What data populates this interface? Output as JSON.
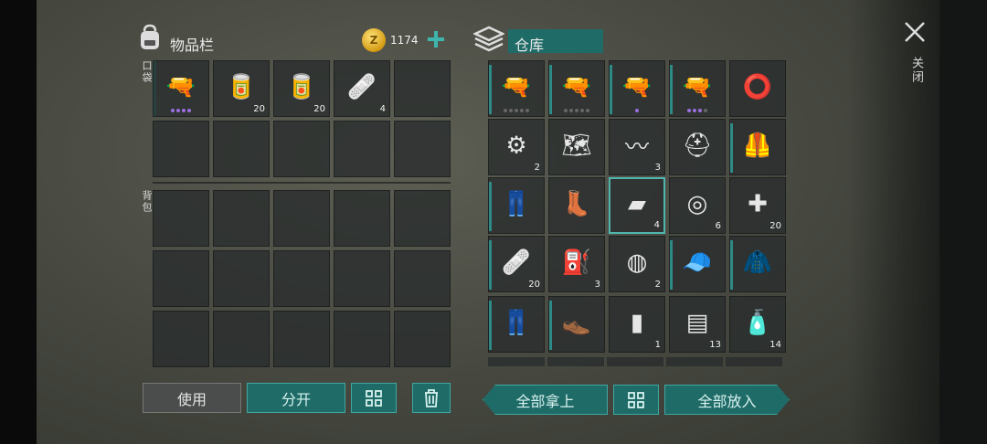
{
  "inventory": {
    "title": "物品栏",
    "pocket_label": "口袋",
    "backpack_label": "背包",
    "coins": "1174",
    "pocket_items": [
      {
        "name": "rifle",
        "count": "",
        "dots": [
          "p",
          "p",
          "p",
          "p"
        ]
      },
      {
        "name": "canned-food",
        "count": "20"
      },
      {
        "name": "canned-food",
        "count": "20"
      },
      {
        "name": "bandage",
        "count": "4"
      }
    ]
  },
  "storage": {
    "title": "仓库",
    "items": [
      {
        "name": "ak-rifle",
        "count": "",
        "dots": [
          "g",
          "g",
          "g",
          "g",
          "g"
        ]
      },
      {
        "name": "ak-rifle",
        "count": "",
        "dots": [
          "g",
          "g",
          "g",
          "g",
          "g"
        ]
      },
      {
        "name": "ak-rifle",
        "count": "",
        "dots": [
          "p"
        ]
      },
      {
        "name": "ak-rifle",
        "count": "",
        "dots": [
          "p",
          "p",
          "p",
          "g"
        ]
      },
      {
        "name": "wheel",
        "count": ""
      },
      {
        "name": "engine-part",
        "count": "2"
      },
      {
        "name": "maps",
        "count": ""
      },
      {
        "name": "spring",
        "count": "3"
      },
      {
        "name": "helmet",
        "count": ""
      },
      {
        "name": "tactical-vest",
        "count": ""
      },
      {
        "name": "pants",
        "count": ""
      },
      {
        "name": "boots",
        "count": ""
      },
      {
        "name": "metal-ingot",
        "count": "4"
      },
      {
        "name": "wire-spool",
        "count": "6"
      },
      {
        "name": "first-aid-bag",
        "count": "20"
      },
      {
        "name": "bandage",
        "count": "20"
      },
      {
        "name": "jerry-can",
        "count": "3"
      },
      {
        "name": "filter",
        "count": "2"
      },
      {
        "name": "camo-cap",
        "count": ""
      },
      {
        "name": "camo-jacket",
        "count": ""
      },
      {
        "name": "camo-pants",
        "count": ""
      },
      {
        "name": "shoes",
        "count": ""
      },
      {
        "name": "spray-can",
        "count": "1"
      },
      {
        "name": "cloth",
        "count": "13"
      },
      {
        "name": "bottle",
        "count": "14"
      }
    ]
  },
  "buttons": {
    "use": "使用",
    "split": "分开",
    "take_all": "全部拿上",
    "put_all": "全部放入"
  },
  "close_label": "关闭",
  "colors": {
    "accent": "#3fa7a0",
    "teal_button": "#1f6b67",
    "coin": "#e0b21b"
  }
}
